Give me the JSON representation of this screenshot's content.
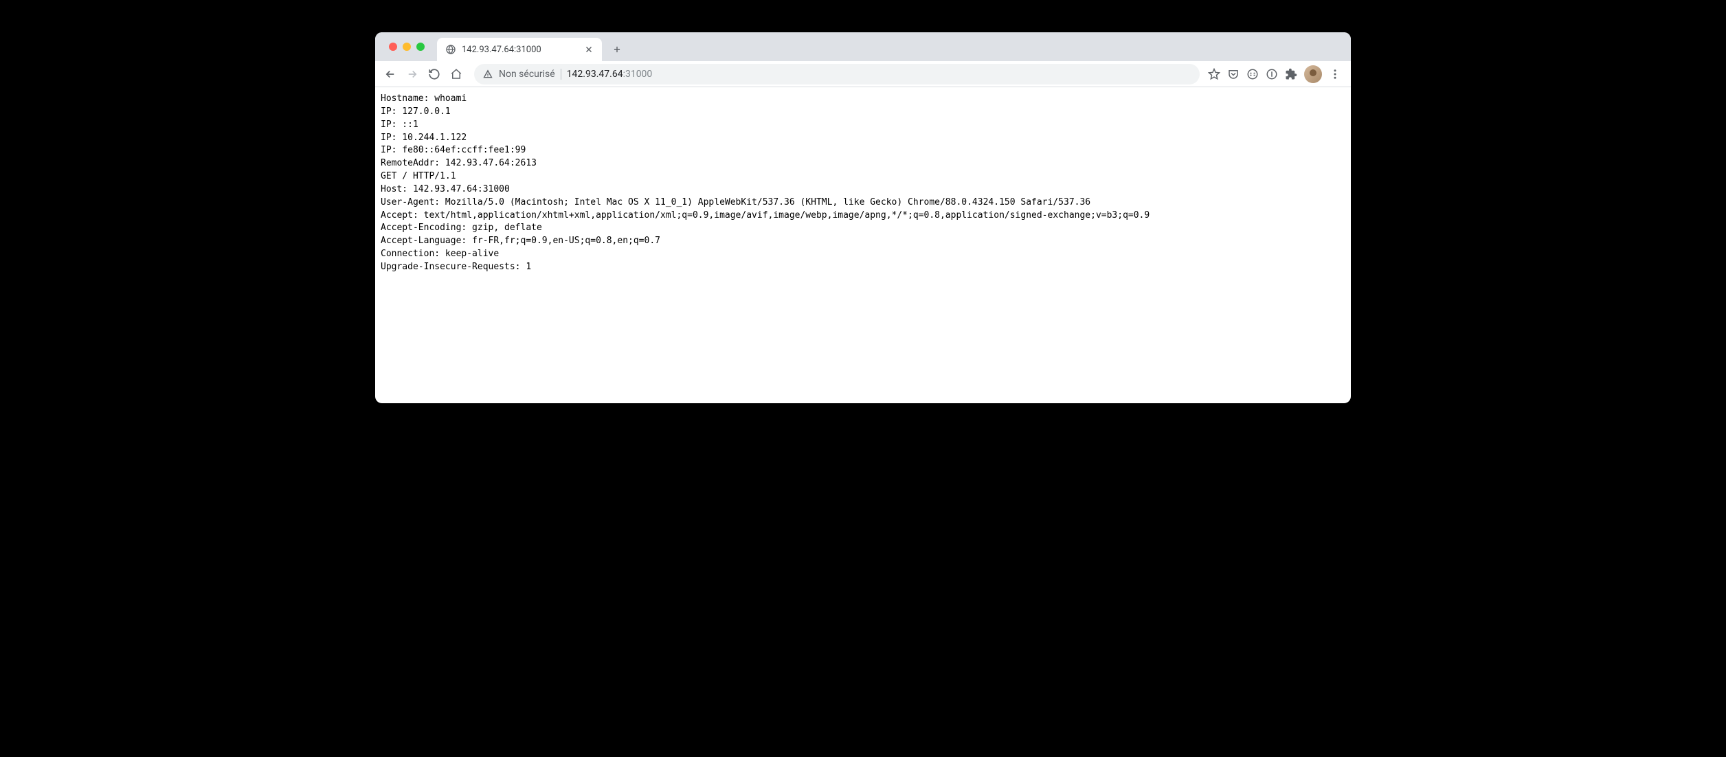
{
  "browser": {
    "tab": {
      "title": "142.93.47.64:31000"
    },
    "addressbar": {
      "security_label": "Non sécurisé",
      "url_host": "142.93.47.64",
      "url_port": ":31000"
    }
  },
  "content": {
    "lines": [
      "Hostname: whoami",
      "IP: 127.0.0.1",
      "IP: ::1",
      "IP: 10.244.1.122",
      "IP: fe80::64ef:ccff:fee1:99",
      "RemoteAddr: 142.93.47.64:2613",
      "GET / HTTP/1.1",
      "Host: 142.93.47.64:31000",
      "User-Agent: Mozilla/5.0 (Macintosh; Intel Mac OS X 11_0_1) AppleWebKit/537.36 (KHTML, like Gecko) Chrome/88.0.4324.150 Safari/537.36",
      "Accept: text/html,application/xhtml+xml,application/xml;q=0.9,image/avif,image/webp,image/apng,*/*;q=0.8,application/signed-exchange;v=b3;q=0.9",
      "Accept-Encoding: gzip, deflate",
      "Accept-Language: fr-FR,fr;q=0.9,en-US;q=0.8,en;q=0.7",
      "Connection: keep-alive",
      "Upgrade-Insecure-Requests: 1"
    ]
  }
}
